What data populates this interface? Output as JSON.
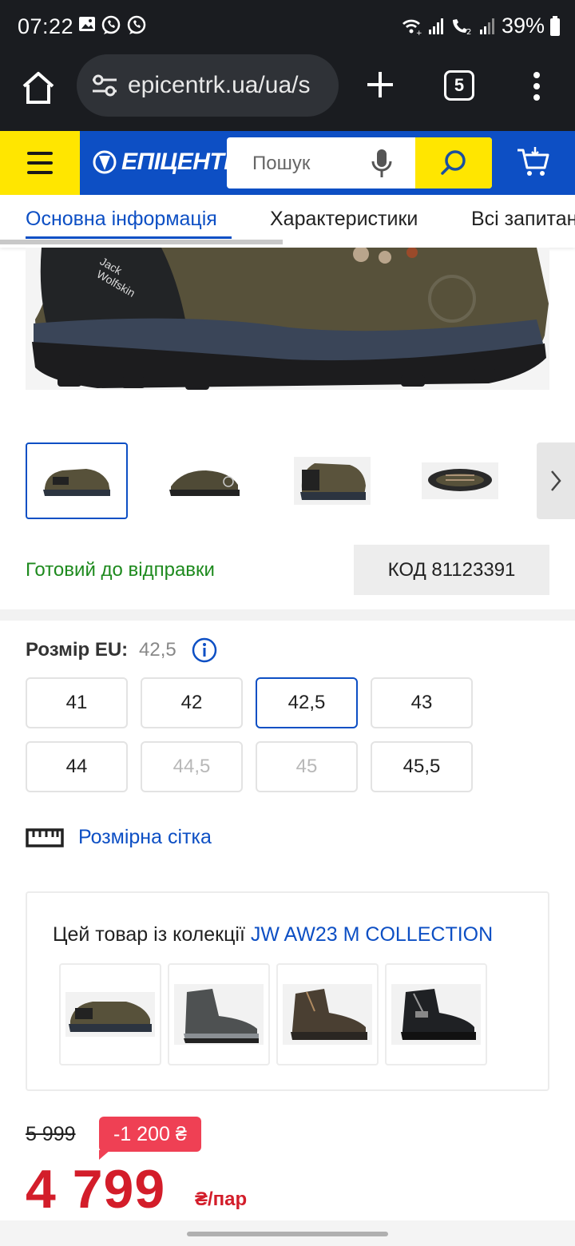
{
  "status_bar": {
    "time": "07:22",
    "battery": "39%"
  },
  "browser": {
    "url": "epicentrk.ua/ua/s",
    "tab_count": "5"
  },
  "site_header": {
    "logo_text": "ЕПІЦЕНТР",
    "search_placeholder": "Пошук",
    "brand_blue": "#0d4fc4",
    "brand_yellow": "#ffe600"
  },
  "tabs": [
    {
      "label": "Основна інформація",
      "active": true
    },
    {
      "label": "Характеристики",
      "active": false
    },
    {
      "label": "Всі запитання",
      "active": false
    }
  ],
  "product": {
    "hero_logo": "Jack Wolfskin",
    "thumbnails_count": 4,
    "availability": "Готовий до відправки",
    "code": "КОД 81123391"
  },
  "sizes": {
    "label": "Розмір EU:",
    "selected": "42,5",
    "options": [
      {
        "value": "41",
        "state": "available"
      },
      {
        "value": "42",
        "state": "available"
      },
      {
        "value": "42,5",
        "state": "selected"
      },
      {
        "value": "43",
        "state": "available"
      },
      {
        "value": "44",
        "state": "available"
      },
      {
        "value": "44,5",
        "state": "unavailable"
      },
      {
        "value": "45",
        "state": "unavailable"
      },
      {
        "value": "45,5",
        "state": "available"
      }
    ],
    "size_chart_link": "Розмірна сітка"
  },
  "collection": {
    "prefix": "Цей товар із колекції ",
    "name": "JW AW23 M COLLECTION",
    "items_count": 4
  },
  "price": {
    "old": "5 999",
    "discount": "-1 200 ₴",
    "current": "4 799",
    "unit": "₴/пар",
    "accent_red": "#d31d2a"
  }
}
